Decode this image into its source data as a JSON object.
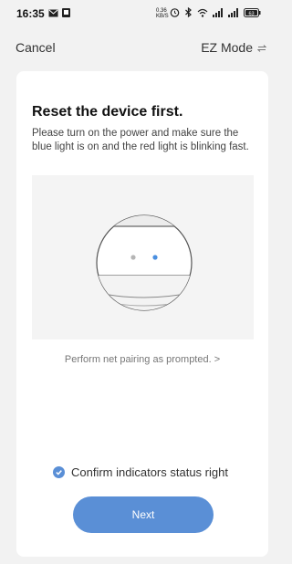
{
  "status_bar": {
    "time": "16:35",
    "network_speed_top": "0.36",
    "network_speed_bottom": "KB/S",
    "battery": "63"
  },
  "nav": {
    "cancel_label": "Cancel",
    "mode_label": "EZ Mode"
  },
  "card": {
    "title": "Reset the device first.",
    "description": "Please turn on the power and make sure the blue light is on and the red light is blinking fast.",
    "prompt_link": "Perform net pairing as prompted. >",
    "confirm_label": "Confirm indicators status right",
    "confirm_checked": true,
    "next_label": "Next"
  },
  "colors": {
    "accent": "#5a8fd6",
    "blue_light": "#4a8fe0",
    "grey_light": "#b5b5b5"
  }
}
